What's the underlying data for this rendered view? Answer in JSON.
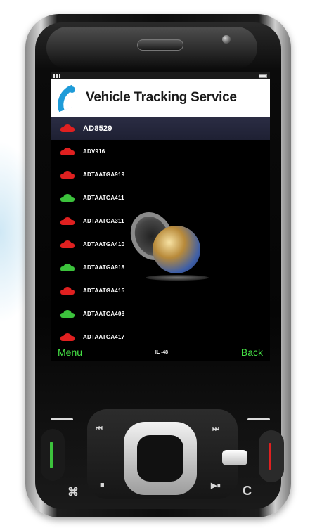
{
  "app": {
    "title": "Vehicle Tracking Service"
  },
  "vehicles": [
    {
      "label": "AD8529",
      "status": "red",
      "selected": true
    },
    {
      "label": "ADV916",
      "status": "red"
    },
    {
      "label": "ADTAATGA919",
      "status": "red"
    },
    {
      "label": "ADTAATGA411",
      "status": "green"
    },
    {
      "label": "ADTAATGA311",
      "status": "red"
    },
    {
      "label": "ADTAATGA410",
      "status": "red"
    },
    {
      "label": "ADTAATGA918",
      "status": "green"
    },
    {
      "label": "ADTAATGA415",
      "status": "red"
    },
    {
      "label": "ADTAATGA408",
      "status": "green"
    },
    {
      "label": "ADTAATGA417",
      "status": "red"
    }
  ],
  "softkeys": {
    "left": "Menu",
    "middle": "IL -48",
    "right": "Back"
  },
  "colors": {
    "accent": "#1e9bd8",
    "status_red": "#e02020",
    "status_green": "#3cc23c",
    "softkey": "#45e045"
  },
  "icons": [
    "telenor-logo-icon",
    "car-icon",
    "signal-icon",
    "battery-icon",
    "globe-icon"
  ],
  "hardware_keys": {
    "rewind": "⏮",
    "forward": "⏭",
    "stop": "■",
    "play_pause": "▶⏸",
    "clear": "C"
  }
}
